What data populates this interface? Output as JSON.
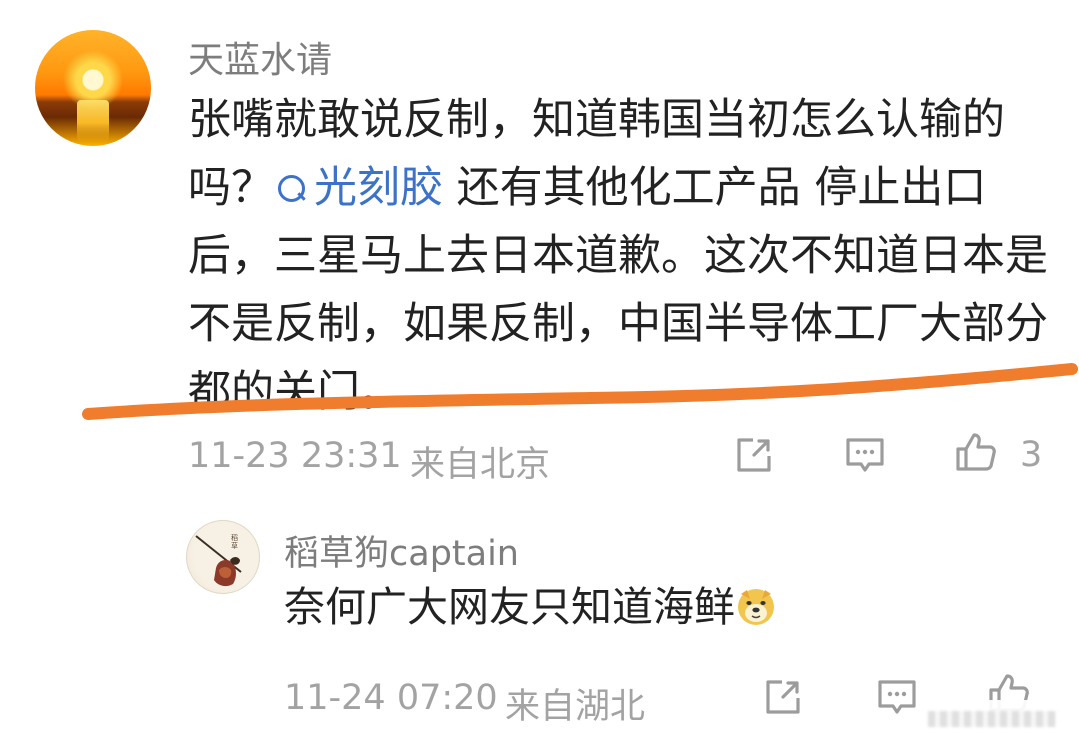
{
  "comment": {
    "username": "天蓝水请",
    "text_before": "张嘴就敢说反制，知道韩国当初怎么认输的吗？",
    "topic": "光刻胶",
    "text_after": " 还有其他化工产品 停止出口后，三星马上去日本道歉。这次不知道日本是不是反制，如果反制，中国半导体工厂大部分都的关门。",
    "time": "11-23 23:31",
    "location": "来自北京",
    "like_count": "3"
  },
  "reply": {
    "username": "稻草狗captain",
    "text": "奈何广大网友只知道海鲜",
    "emoji": "doge-emoji",
    "time": "11-24 07:20",
    "location": "来自湖北"
  },
  "icons": {
    "share": "share-icon",
    "reply": "comment-icon",
    "like": "thumb-up-icon",
    "topic": "search-icon"
  },
  "colors": {
    "link": "#3c73c8",
    "underline": "#f07d2d",
    "meta_text": "#a3a3a3",
    "body_text": "#222222",
    "username_text": "#7d7d7d"
  }
}
